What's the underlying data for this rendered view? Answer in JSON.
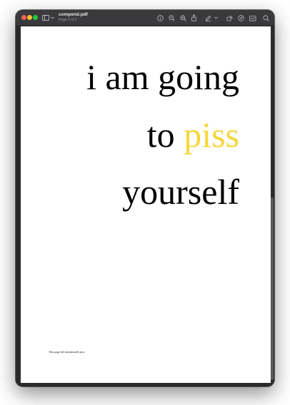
{
  "window": {
    "title": "compend.pdf",
    "subtitle": "Page 2 of 2"
  },
  "toolbar": {
    "icons": [
      "info-icon",
      "zoom-out-icon",
      "zoom-in-icon",
      "share-icon",
      "markup-pen-icon",
      "chevron-down-icon",
      "rotate-icon",
      "annotate-icon",
      "sign-icon",
      "search-icon"
    ]
  },
  "page": {
    "line1": "i am going",
    "line2_prefix": "to ",
    "line2_accent": "piss",
    "line3": "yourself",
    "footnote": "This page left intentionally piss",
    "accent_color": "#f5d63c"
  }
}
